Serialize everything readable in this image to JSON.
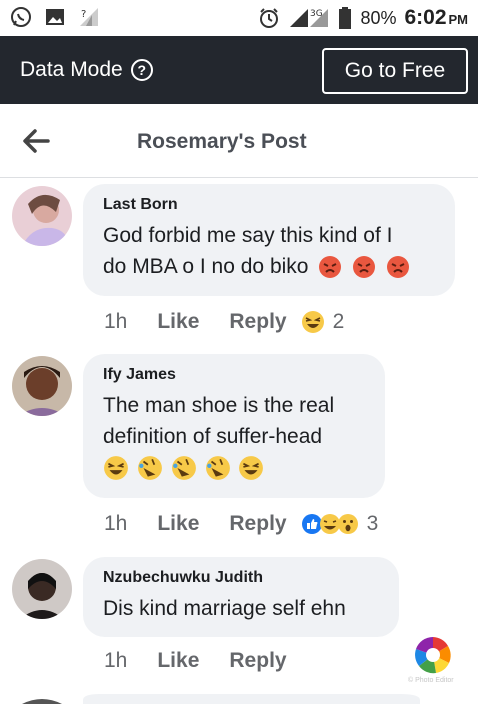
{
  "status_bar": {
    "battery": "80%",
    "time": "6:02",
    "ampm": "PM",
    "network": "3G"
  },
  "data_bar": {
    "label": "Data Mode",
    "help_glyph": "?",
    "go_free_label": "Go to Free"
  },
  "header": {
    "title": "Rosemary's Post"
  },
  "comments": [
    {
      "author": "Last Born",
      "line1": "God forbid me say this kind of I",
      "line2": "do MBA o I no do biko",
      "time": "1h",
      "like": "Like",
      "reply": "Reply",
      "reaction_count": "2"
    },
    {
      "author": "Ify James",
      "line1": "The man shoe is the real",
      "line2": "definition of suffer-head",
      "time": "1h",
      "like": "Like",
      "reply": "Reply",
      "reaction_count": "3"
    },
    {
      "author": "Nzubechuwku Judith",
      "line1": "Dis kind marriage self ehn",
      "time": "1h",
      "like": "Like",
      "reply": "Reply"
    }
  ],
  "watermark": "© Photo Editor",
  "colors": {
    "data_bar": "#23272e",
    "bubble": "#f0f2f5",
    "muted": "#65676b",
    "angry_emoji": "#e9573f",
    "laugh_emoji": "#f7c948",
    "like_blue": "#1877f2"
  }
}
